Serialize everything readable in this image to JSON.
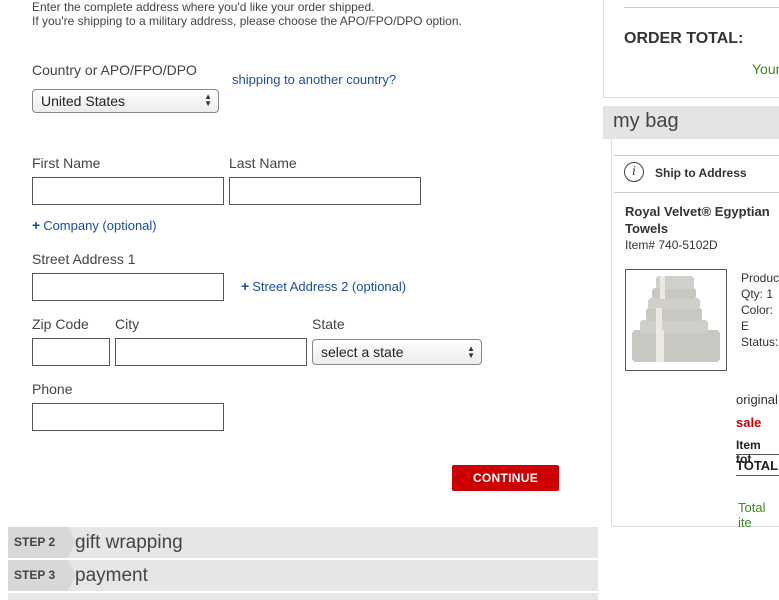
{
  "intro": {
    "line1": "Enter the complete address where you'd like your order shipped.",
    "line2": "If you're shipping to a military address, please choose the APO/FPO/DPO option."
  },
  "form": {
    "country_label": "Country or APO/FPO/DPO",
    "country_value": "United States",
    "shipping_link": "shipping to another country?",
    "first_name_label": "First Name",
    "last_name_label": "Last Name",
    "company_link": "Company (optional)",
    "street1_label": "Street Address 1",
    "street2_link": "Street Address 2 (optional)",
    "zip_label": "Zip Code",
    "city_label": "City",
    "state_label": "State",
    "state_value": "select a state",
    "phone_label": "Phone",
    "continue_label": "CONTINUE"
  },
  "steps": [
    {
      "num": "STEP 2",
      "title": "gift wrapping"
    },
    {
      "num": "STEP 3",
      "title": "payment"
    }
  ],
  "summary": {
    "order_total_label": "ORDER TOTAL:",
    "your_text": "Your"
  },
  "bag": {
    "title": "my bag",
    "ship_to": "Ship to Address",
    "product_name_1": "Royal Velvet® Egyptian",
    "product_name_2": "Towels",
    "item_number": "Item# 740-5102D",
    "product_label": "Produc",
    "qty": "Qty: 1",
    "color": "Color: E",
    "status": "Status:",
    "original": "original",
    "sale": "sale",
    "item_total": "Item tot",
    "total": "TOTAL:",
    "total_items": "Total ite"
  },
  "colors": {
    "continue_red": "#cc0000",
    "link_blue": "#1a4e9a",
    "sale_red": "#cc0000",
    "green": "#3a8a1a"
  }
}
